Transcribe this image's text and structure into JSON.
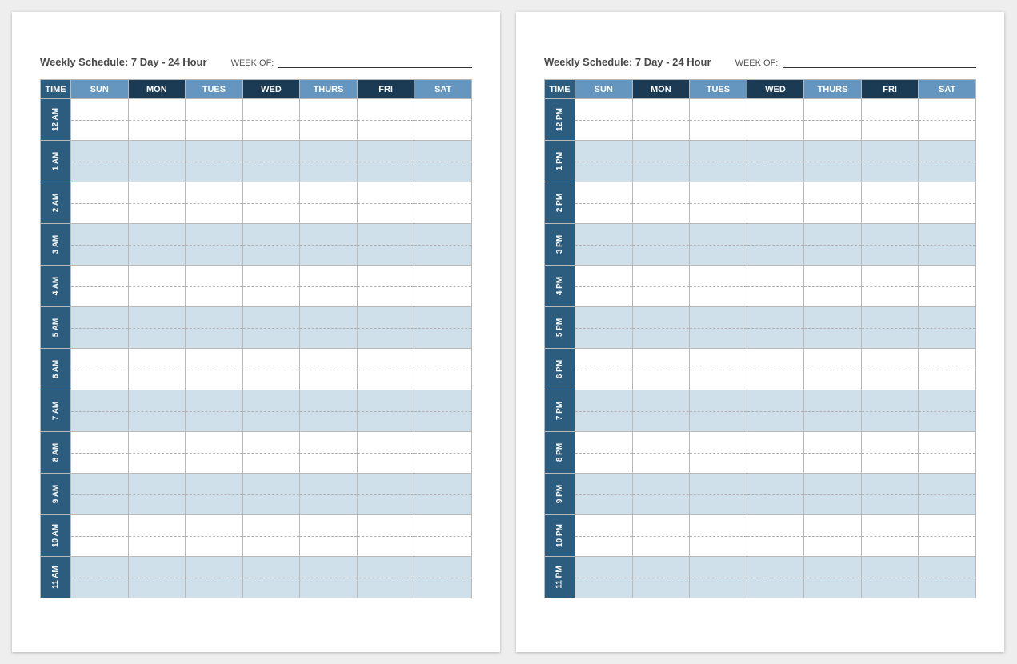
{
  "title": "Weekly Schedule: 7 Day - 24 Hour",
  "weekof_label": "WEEK OF:",
  "headers": {
    "time": "TIME",
    "days": [
      {
        "label": "SUN",
        "style": "light"
      },
      {
        "label": "MON",
        "style": "dark"
      },
      {
        "label": "TUES",
        "style": "light"
      },
      {
        "label": "WED",
        "style": "dark"
      },
      {
        "label": "THURS",
        "style": "light"
      },
      {
        "label": "FRI",
        "style": "dark"
      },
      {
        "label": "SAT",
        "style": "light"
      }
    ]
  },
  "pages": [
    {
      "times": [
        "12 AM",
        "1 AM",
        "2 AM",
        "3 AM",
        "4 AM",
        "5 AM",
        "6 AM",
        "7 AM",
        "8 AM",
        "9 AM",
        "10 AM",
        "11 AM"
      ]
    },
    {
      "times": [
        "12 PM",
        "1 PM",
        "2 PM",
        "3 PM",
        "4 PM",
        "5 PM",
        "6 PM",
        "7 PM",
        "8 PM",
        "9 PM",
        "10 PM",
        "11 PM"
      ]
    }
  ]
}
